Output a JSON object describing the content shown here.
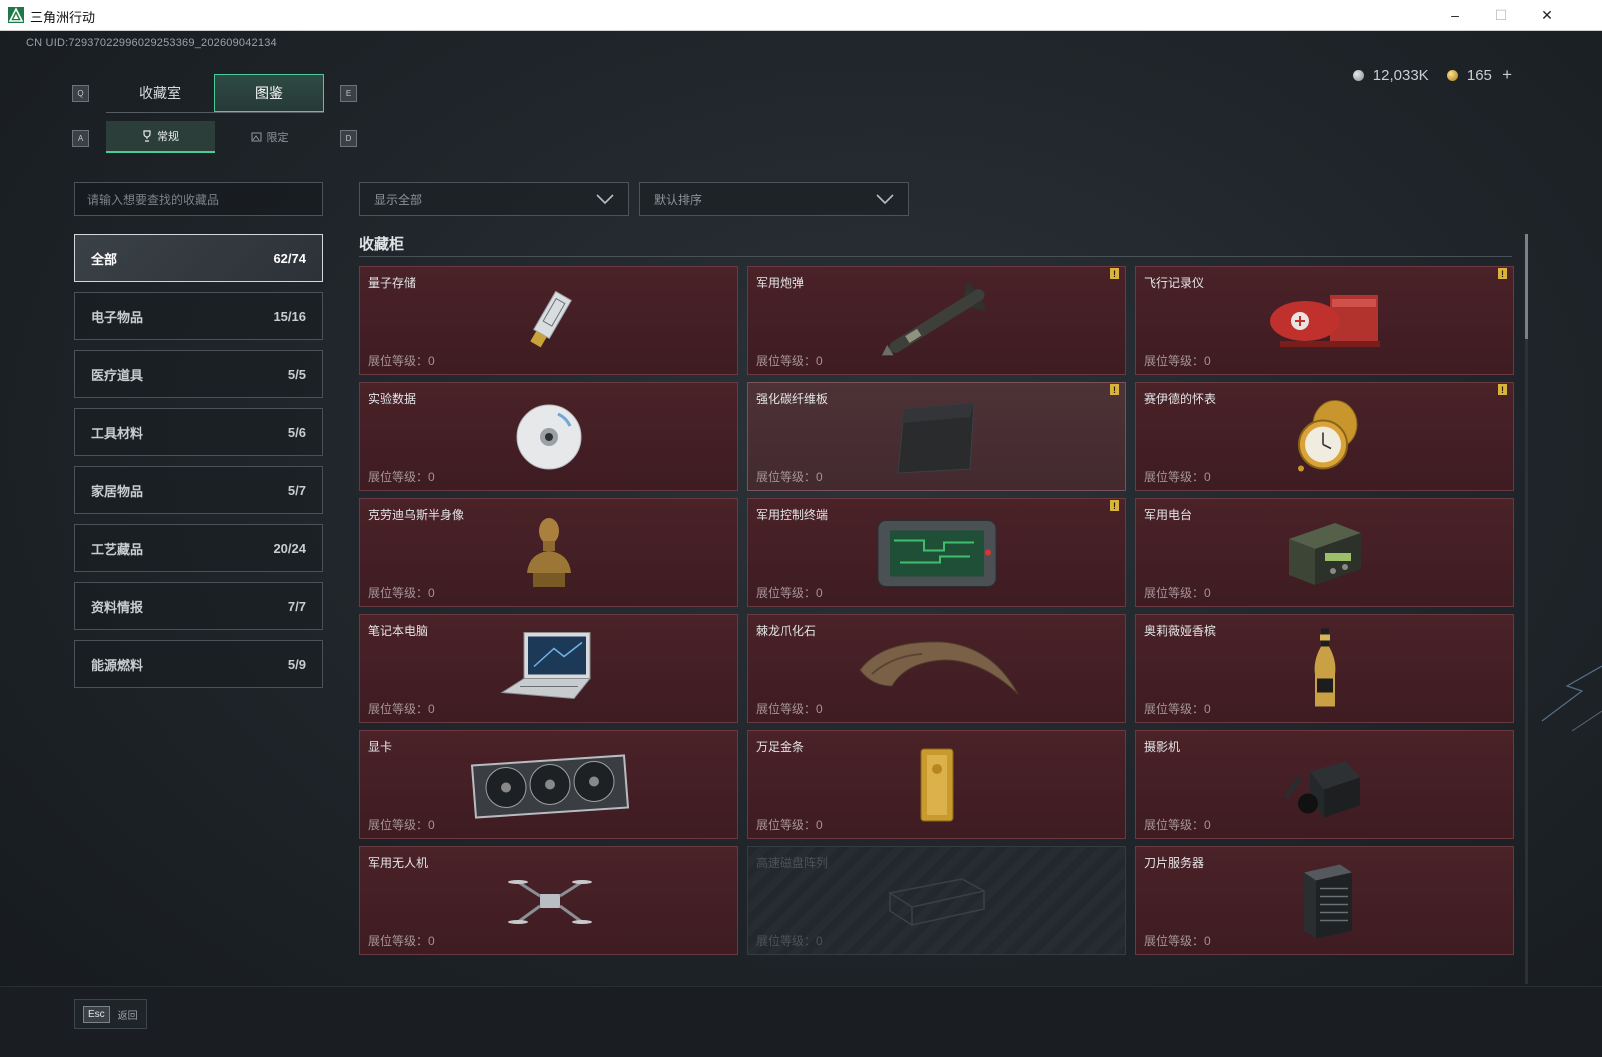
{
  "window": {
    "title": "三角洲行动",
    "minimize": "–",
    "maximize": "☐",
    "close": "✕"
  },
  "uid": "CN UID:7293702299602925336​9_202609042134",
  "currency": {
    "credits": "12,033K",
    "coins": "165",
    "add": "+"
  },
  "keys": {
    "q": "Q",
    "e": "E",
    "a": "A",
    "d": "D"
  },
  "tabs": [
    {
      "label": "收藏室"
    },
    {
      "label": "图鉴"
    }
  ],
  "subtabs": [
    {
      "label": "常规"
    },
    {
      "label": "限定"
    }
  ],
  "search": {
    "placeholder": "请输入想要查找的收藏品"
  },
  "filters": {
    "display": "显示全部",
    "sort": "默认排序"
  },
  "categories": [
    {
      "label": "全部",
      "count": "62/74"
    },
    {
      "label": "电子物品",
      "count": "15/16"
    },
    {
      "label": "医疗道具",
      "count": "5/5"
    },
    {
      "label": "工具材料",
      "count": "5/6"
    },
    {
      "label": "家居物品",
      "count": "5/7"
    },
    {
      "label": "工艺藏品",
      "count": "20/24"
    },
    {
      "label": "资料情报",
      "count": "7/7"
    },
    {
      "label": "能源燃料",
      "count": "5/9"
    }
  ],
  "section_title": "收藏柜",
  "items": [
    {
      "name": "量子存储",
      "level": "展位等级：0",
      "badge": ""
    },
    {
      "name": "军用炮弹",
      "level": "展位等级：0",
      "badge": "!"
    },
    {
      "name": "飞行记录仪",
      "level": "展位等级：0",
      "badge": "!"
    },
    {
      "name": "实验数据",
      "level": "展位等级：0",
      "badge": ""
    },
    {
      "name": "强化碳纤维板",
      "level": "展位等级：0",
      "badge": "!"
    },
    {
      "name": "赛伊德的怀表",
      "level": "展位等级：0",
      "badge": "!"
    },
    {
      "name": "克劳迪乌斯半身像",
      "level": "展位等级：0",
      "badge": ""
    },
    {
      "name": "军用控制终端",
      "level": "展位等级：0",
      "badge": "!"
    },
    {
      "name": "军用电台",
      "level": "展位等级：0",
      "badge": ""
    },
    {
      "name": "笔记本电脑",
      "level": "展位等级：0",
      "badge": ""
    },
    {
      "name": "棘龙爪化石",
      "level": "展位等级：0",
      "badge": ""
    },
    {
      "name": "奥莉薇娅香槟",
      "level": "展位等级：0",
      "badge": ""
    },
    {
      "name": "显卡",
      "level": "展位等级：0",
      "badge": ""
    },
    {
      "name": "万足金条",
      "level": "展位等级：0",
      "badge": ""
    },
    {
      "name": "摄影机",
      "level": "展位等级：0",
      "badge": ""
    },
    {
      "name": "军用无人机",
      "level": "展位等级：0",
      "badge": ""
    },
    {
      "name": "高速磁盘阵列",
      "level": "展位等级：0",
      "badge": ""
    },
    {
      "name": "刀片服务器",
      "level": "展位等级：0",
      "badge": ""
    }
  ],
  "footer": {
    "esc_key": "Esc",
    "back_label": "返回"
  },
  "colors": {
    "accent": "#4ec99a",
    "card_bg": "#4a2228",
    "badge": "#d8b43a"
  }
}
